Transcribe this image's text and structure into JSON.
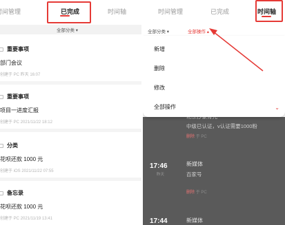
{
  "left": {
    "tabs": [
      "时间管理",
      "已完成",
      "时间轴"
    ],
    "active_tab": "已完成",
    "filter": "全部分类 ▾",
    "entries": [
      {
        "category": "重要事项",
        "text": "部门会议",
        "meta": "创建于 PC  昨天 16:07"
      },
      {
        "category": "重要事项",
        "text": "项目一进度汇报",
        "meta": "创建于 PC  2021/11/22 18:12"
      },
      {
        "category": "分类",
        "text": "花呗还款 1000 元",
        "meta": "创建于 iOS  2021/11/22 07:55"
      },
      {
        "category": "备忘录",
        "text": "花呗还款 1000 元",
        "meta": "创建于 PC  2021/11/19 13:41"
      }
    ]
  },
  "right": {
    "tabs": [
      "时间管理",
      "已完成",
      "时间轴"
    ],
    "active_tab": "时间轴",
    "filter_category": "全部分类 ▾",
    "filter_action": "全部操作 ▴",
    "menu": [
      "新增",
      "删除",
      "修改",
      "全部操作"
    ],
    "menu_chevron": "⌄",
    "timeline": [
      {
        "lines": [
          "北京抄豪育元",
          "中级已认证，v认证需要1000粉"
        ],
        "meta_action": "删除",
        "meta_rest": "于 PC"
      },
      {
        "time": "17:46",
        "sub": "昨天",
        "title": "新媒体",
        "line": "百家号",
        "meta_action": "删除",
        "meta_rest": "于 PC"
      },
      {
        "time": "17:44",
        "sub": "",
        "title": "新媒体",
        "line": "",
        "meta_action": "",
        "meta_rest": ""
      }
    ]
  },
  "colors": {
    "accent": "#e53935",
    "overlay": "#5a5a5a"
  }
}
